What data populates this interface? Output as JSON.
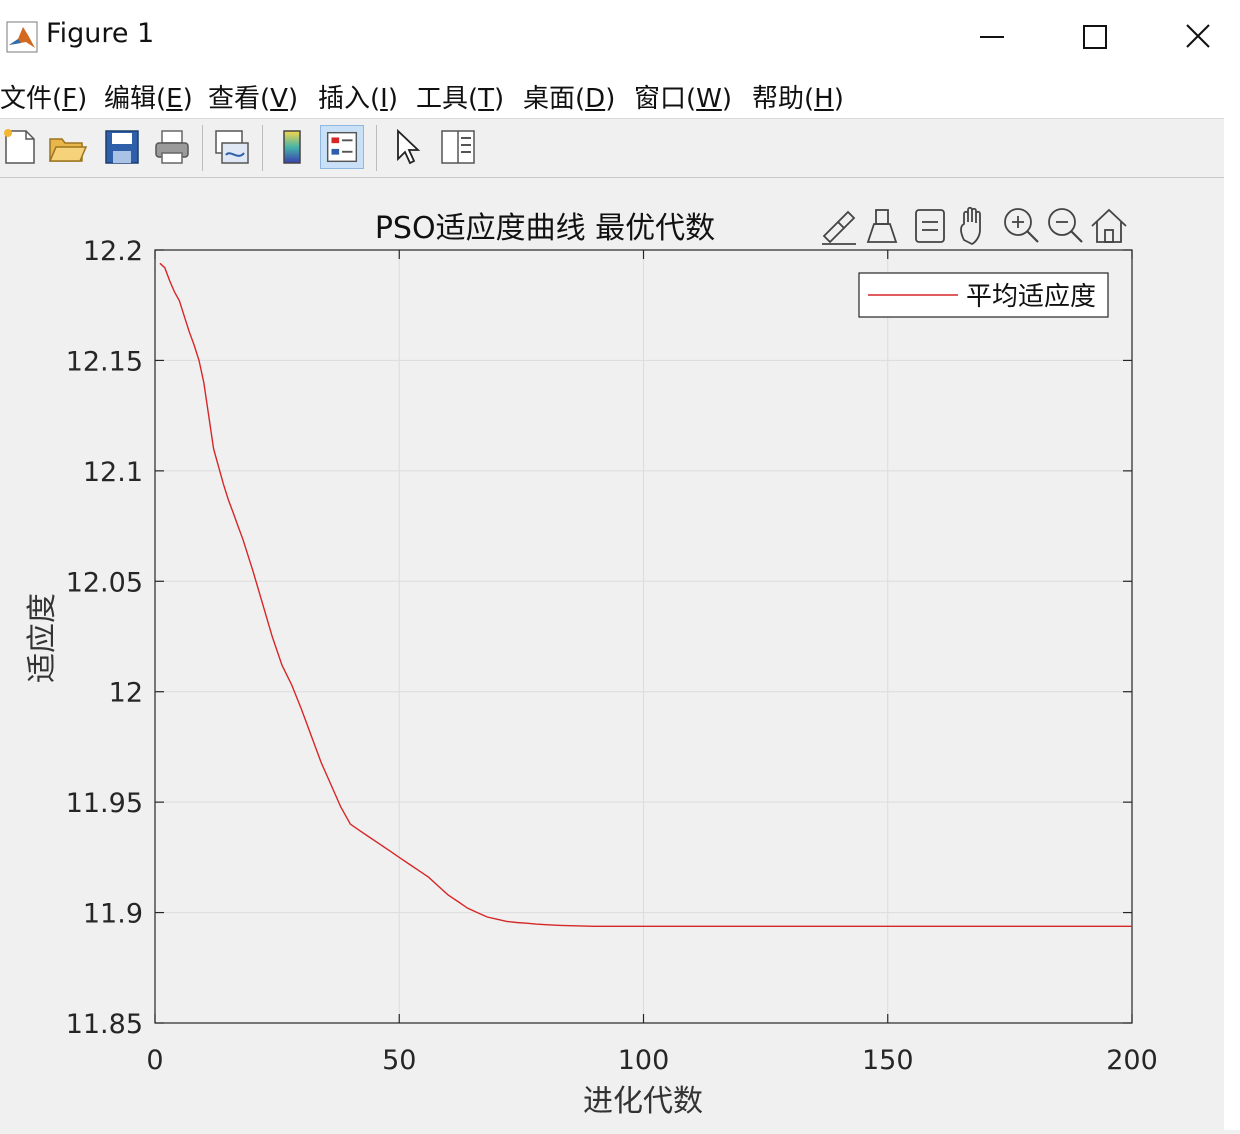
{
  "window": {
    "title": "Figure 1",
    "controls": [
      "minimize-icon",
      "maximize-icon",
      "close-icon"
    ]
  },
  "menu": [
    {
      "text": "文件(",
      "key": "F",
      "close": ")"
    },
    {
      "text": "编辑(",
      "key": "E",
      "close": ")"
    },
    {
      "text": "查看(",
      "key": "V",
      "close": ")"
    },
    {
      "text": "插入(",
      "key": "I",
      "close": ")"
    },
    {
      "text": "工具(",
      "key": "T",
      "close": ")"
    },
    {
      "text": "桌面(",
      "key": "D",
      "close": ")"
    },
    {
      "text": "窗口(",
      "key": "W",
      "close": ")"
    },
    {
      "text": "帮助(",
      "key": "H",
      "close": ")"
    }
  ],
  "toolbar": {
    "buttons": [
      "new-figure-icon",
      "open-file-icon",
      "save-icon",
      "print-icon",
      "link-plot-icon",
      "colorbar-icon",
      "legend-icon",
      "edit-plot-pointer-icon",
      "property-inspector-icon"
    ],
    "active": "legend-icon"
  },
  "axes_toolbar": [
    "brush-icon",
    "data-tips-icon",
    "data-cursor-icon",
    "pan-icon",
    "zoom-in-icon",
    "zoom-out-icon",
    "restore-view-icon"
  ],
  "colors": {
    "line": "#d62728",
    "grid": "#dcdcdc",
    "axis": "#262626"
  },
  "chart_data": {
    "type": "line",
    "title": "PSO适应度曲线  最优代数",
    "xlabel": "进化代数",
    "ylabel": "适应度",
    "xlim": [
      0,
      200
    ],
    "ylim": [
      11.85,
      12.2
    ],
    "xticks": [
      "0",
      "50",
      "100",
      "150",
      "200"
    ],
    "yticks": [
      "12.2",
      "12.15",
      "12.1",
      "12.05",
      "12",
      "11.95",
      "11.9",
      "11.85"
    ],
    "grid": true,
    "legend": {
      "position": "top-right",
      "entries": [
        "平均适应度"
      ]
    },
    "series": [
      {
        "name": "平均适应度",
        "x": [
          1,
          2,
          3,
          4,
          5,
          6,
          7,
          8,
          9,
          10,
          11,
          12,
          13,
          14,
          15,
          16,
          17,
          18,
          19,
          20,
          22,
          24,
          26,
          28,
          30,
          32,
          34,
          36,
          38,
          40,
          42,
          44,
          46,
          48,
          50,
          52,
          54,
          56,
          58,
          60,
          62,
          64,
          66,
          68,
          70,
          72,
          74,
          76,
          78,
          80,
          83,
          86,
          90,
          95,
          100,
          110,
          120,
          130,
          140,
          150,
          160,
          170,
          180,
          190,
          200
        ],
        "y": [
          12.194,
          12.192,
          12.186,
          12.181,
          12.177,
          12.17,
          12.163,
          12.157,
          12.15,
          12.14,
          12.125,
          12.11,
          12.102,
          12.094,
          12.087,
          12.081,
          12.075,
          12.069,
          12.062,
          12.055,
          12.04,
          12.025,
          12.012,
          12.003,
          11.992,
          11.98,
          11.968,
          11.958,
          11.948,
          11.94,
          11.937,
          11.934,
          11.931,
          11.928,
          11.925,
          11.922,
          11.919,
          11.916,
          11.912,
          11.908,
          11.905,
          11.902,
          11.9,
          11.898,
          11.897,
          11.896,
          11.8955,
          11.8952,
          11.8948,
          11.8945,
          11.8942,
          11.894,
          11.8938,
          11.8938,
          11.8938,
          11.8938,
          11.8938,
          11.8938,
          11.8938,
          11.8938,
          11.8938,
          11.8938,
          11.8938,
          11.8938,
          11.8938
        ]
      }
    ]
  }
}
